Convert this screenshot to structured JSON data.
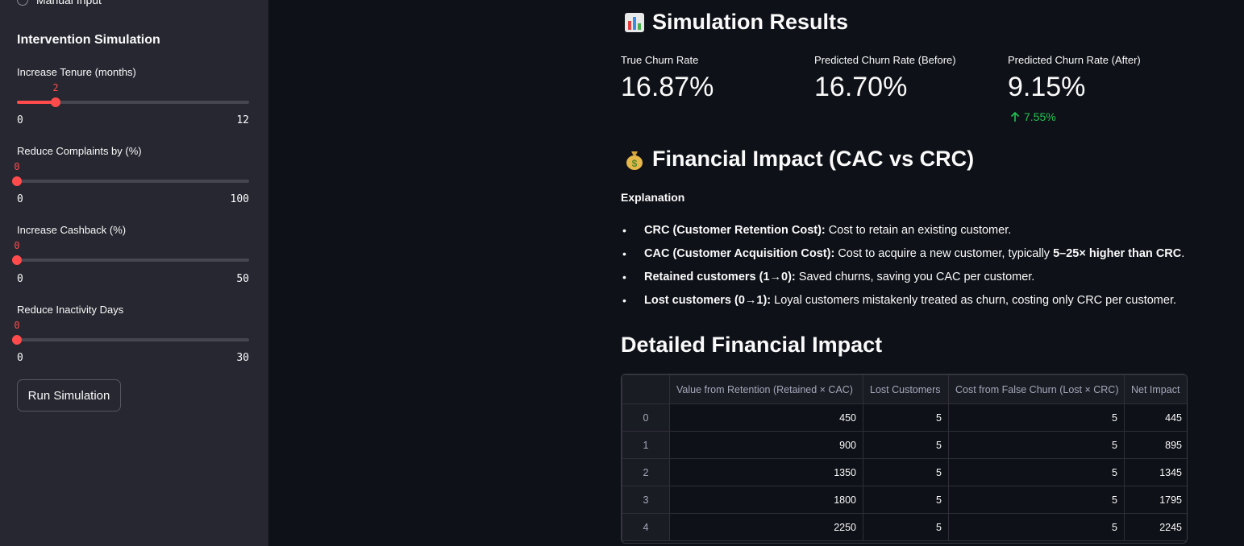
{
  "sidebar": {
    "radio_label": "Manual Input",
    "section_title": "Intervention Simulation",
    "sliders": [
      {
        "label": "Increase Tenure (months)",
        "value": "2",
        "min": "0",
        "max": "12",
        "fraction": 0.1667
      },
      {
        "label": "Reduce Complaints by (%)",
        "value": "0",
        "min": "0",
        "max": "100",
        "fraction": 0
      },
      {
        "label": "Increase Cashback (%)",
        "value": "0",
        "min": "0",
        "max": "50",
        "fraction": 0
      },
      {
        "label": "Reduce Inactivity Days",
        "value": "0",
        "min": "0",
        "max": "30",
        "fraction": 0
      }
    ],
    "run_button": "Run Simulation"
  },
  "results": {
    "title": "Simulation Results",
    "icon": "bar-chart-icon",
    "metrics": [
      {
        "label": "True Churn Rate",
        "value": "16.87%"
      },
      {
        "label": "Predicted Churn Rate (Before)",
        "value": "16.70%"
      },
      {
        "label": "Predicted Churn Rate (After)",
        "value": "9.15%",
        "delta": "7.55%"
      }
    ]
  },
  "financial": {
    "title": "Financial Impact (CAC vs CRC)",
    "icon": "money-bag-icon",
    "explanation_title": "Explanation",
    "bullets": [
      {
        "bold": "CRC (Customer Retention Cost):",
        "text": " Cost to retain an existing customer."
      },
      {
        "bold": "CAC (Customer Acquisition Cost):",
        "text": " Cost to acquire a new customer, typically ",
        "bold2": "5–25× higher than CRC",
        "tail": "."
      },
      {
        "bold": "Retained customers (1→0):",
        "text": " Saved churns, saving you CAC per customer."
      },
      {
        "bold": "Lost customers (0→1):",
        "text": " Loyal customers mistakenly treated as churn, costing only CRC per customer."
      }
    ]
  },
  "detailed": {
    "title": "Detailed Financial Impact",
    "columns": [
      "",
      "Value from Retention (Retained × CAC)",
      "Lost Customers",
      "Cost from False Churn (Lost × CRC)",
      "Net Impact"
    ],
    "rows": [
      [
        "0",
        "450",
        "5",
        "5",
        "445"
      ],
      [
        "1",
        "900",
        "5",
        "5",
        "895"
      ],
      [
        "2",
        "1350",
        "5",
        "5",
        "1345"
      ],
      [
        "3",
        "1800",
        "5",
        "5",
        "1795"
      ],
      [
        "4",
        "2250",
        "5",
        "5",
        "2245"
      ]
    ]
  },
  "colors": {
    "accent": "#ff4b4b",
    "delta_positive": "#21c354",
    "sidebar_bg": "#262730",
    "main_bg": "#0e1117"
  }
}
